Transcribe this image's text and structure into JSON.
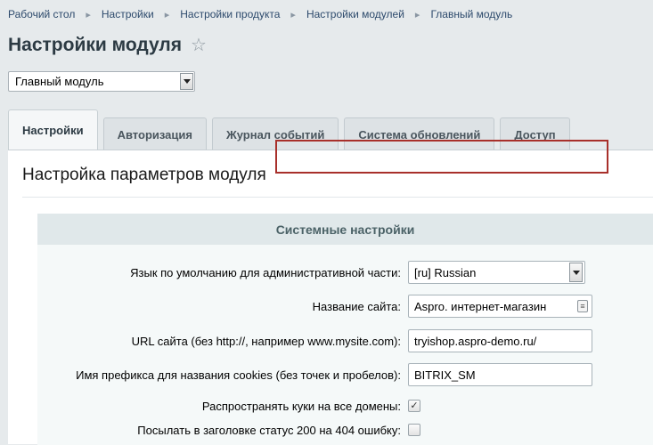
{
  "breadcrumb": [
    "Рабочий стол",
    "Настройки",
    "Настройки продукта",
    "Настройки модулей",
    "Главный модуль"
  ],
  "page": {
    "title": "Настройки модуля"
  },
  "module_select": {
    "value": "Главный модуль"
  },
  "tabs": [
    {
      "label": "Настройки",
      "active": true
    },
    {
      "label": "Авторизация"
    },
    {
      "label": "Журнал событий"
    },
    {
      "label": "Система обновлений"
    },
    {
      "label": "Доступ"
    }
  ],
  "panel": {
    "title": "Настройка параметров модуля"
  },
  "section": {
    "header": "Системные настройки"
  },
  "fields": {
    "language": {
      "label": "Язык по умолчанию для административной части:",
      "value": "[ru] Russian"
    },
    "site_name": {
      "label": "Название сайта:",
      "value": "Aspro. интернет-магазин"
    },
    "site_url": {
      "label": "URL сайта (без http://, например www.mysite.com):",
      "value": "tryishop.aspro-demo.ru/"
    },
    "cookie_prefix": {
      "label": "Имя префикса для названия cookies (без точек и пробелов):",
      "value": "BITRIX_SM"
    },
    "share_cookies": {
      "label": "Распространять куки на все домены:",
      "checked": true
    },
    "status_200": {
      "label": "Посылать в заголовке статус 200 на 404 ошибку:",
      "checked": false
    }
  },
  "colors": {
    "highlight": "#a8302b",
    "section_header_bg": "#e0e8ea",
    "page_bg": "#e6eaec"
  }
}
